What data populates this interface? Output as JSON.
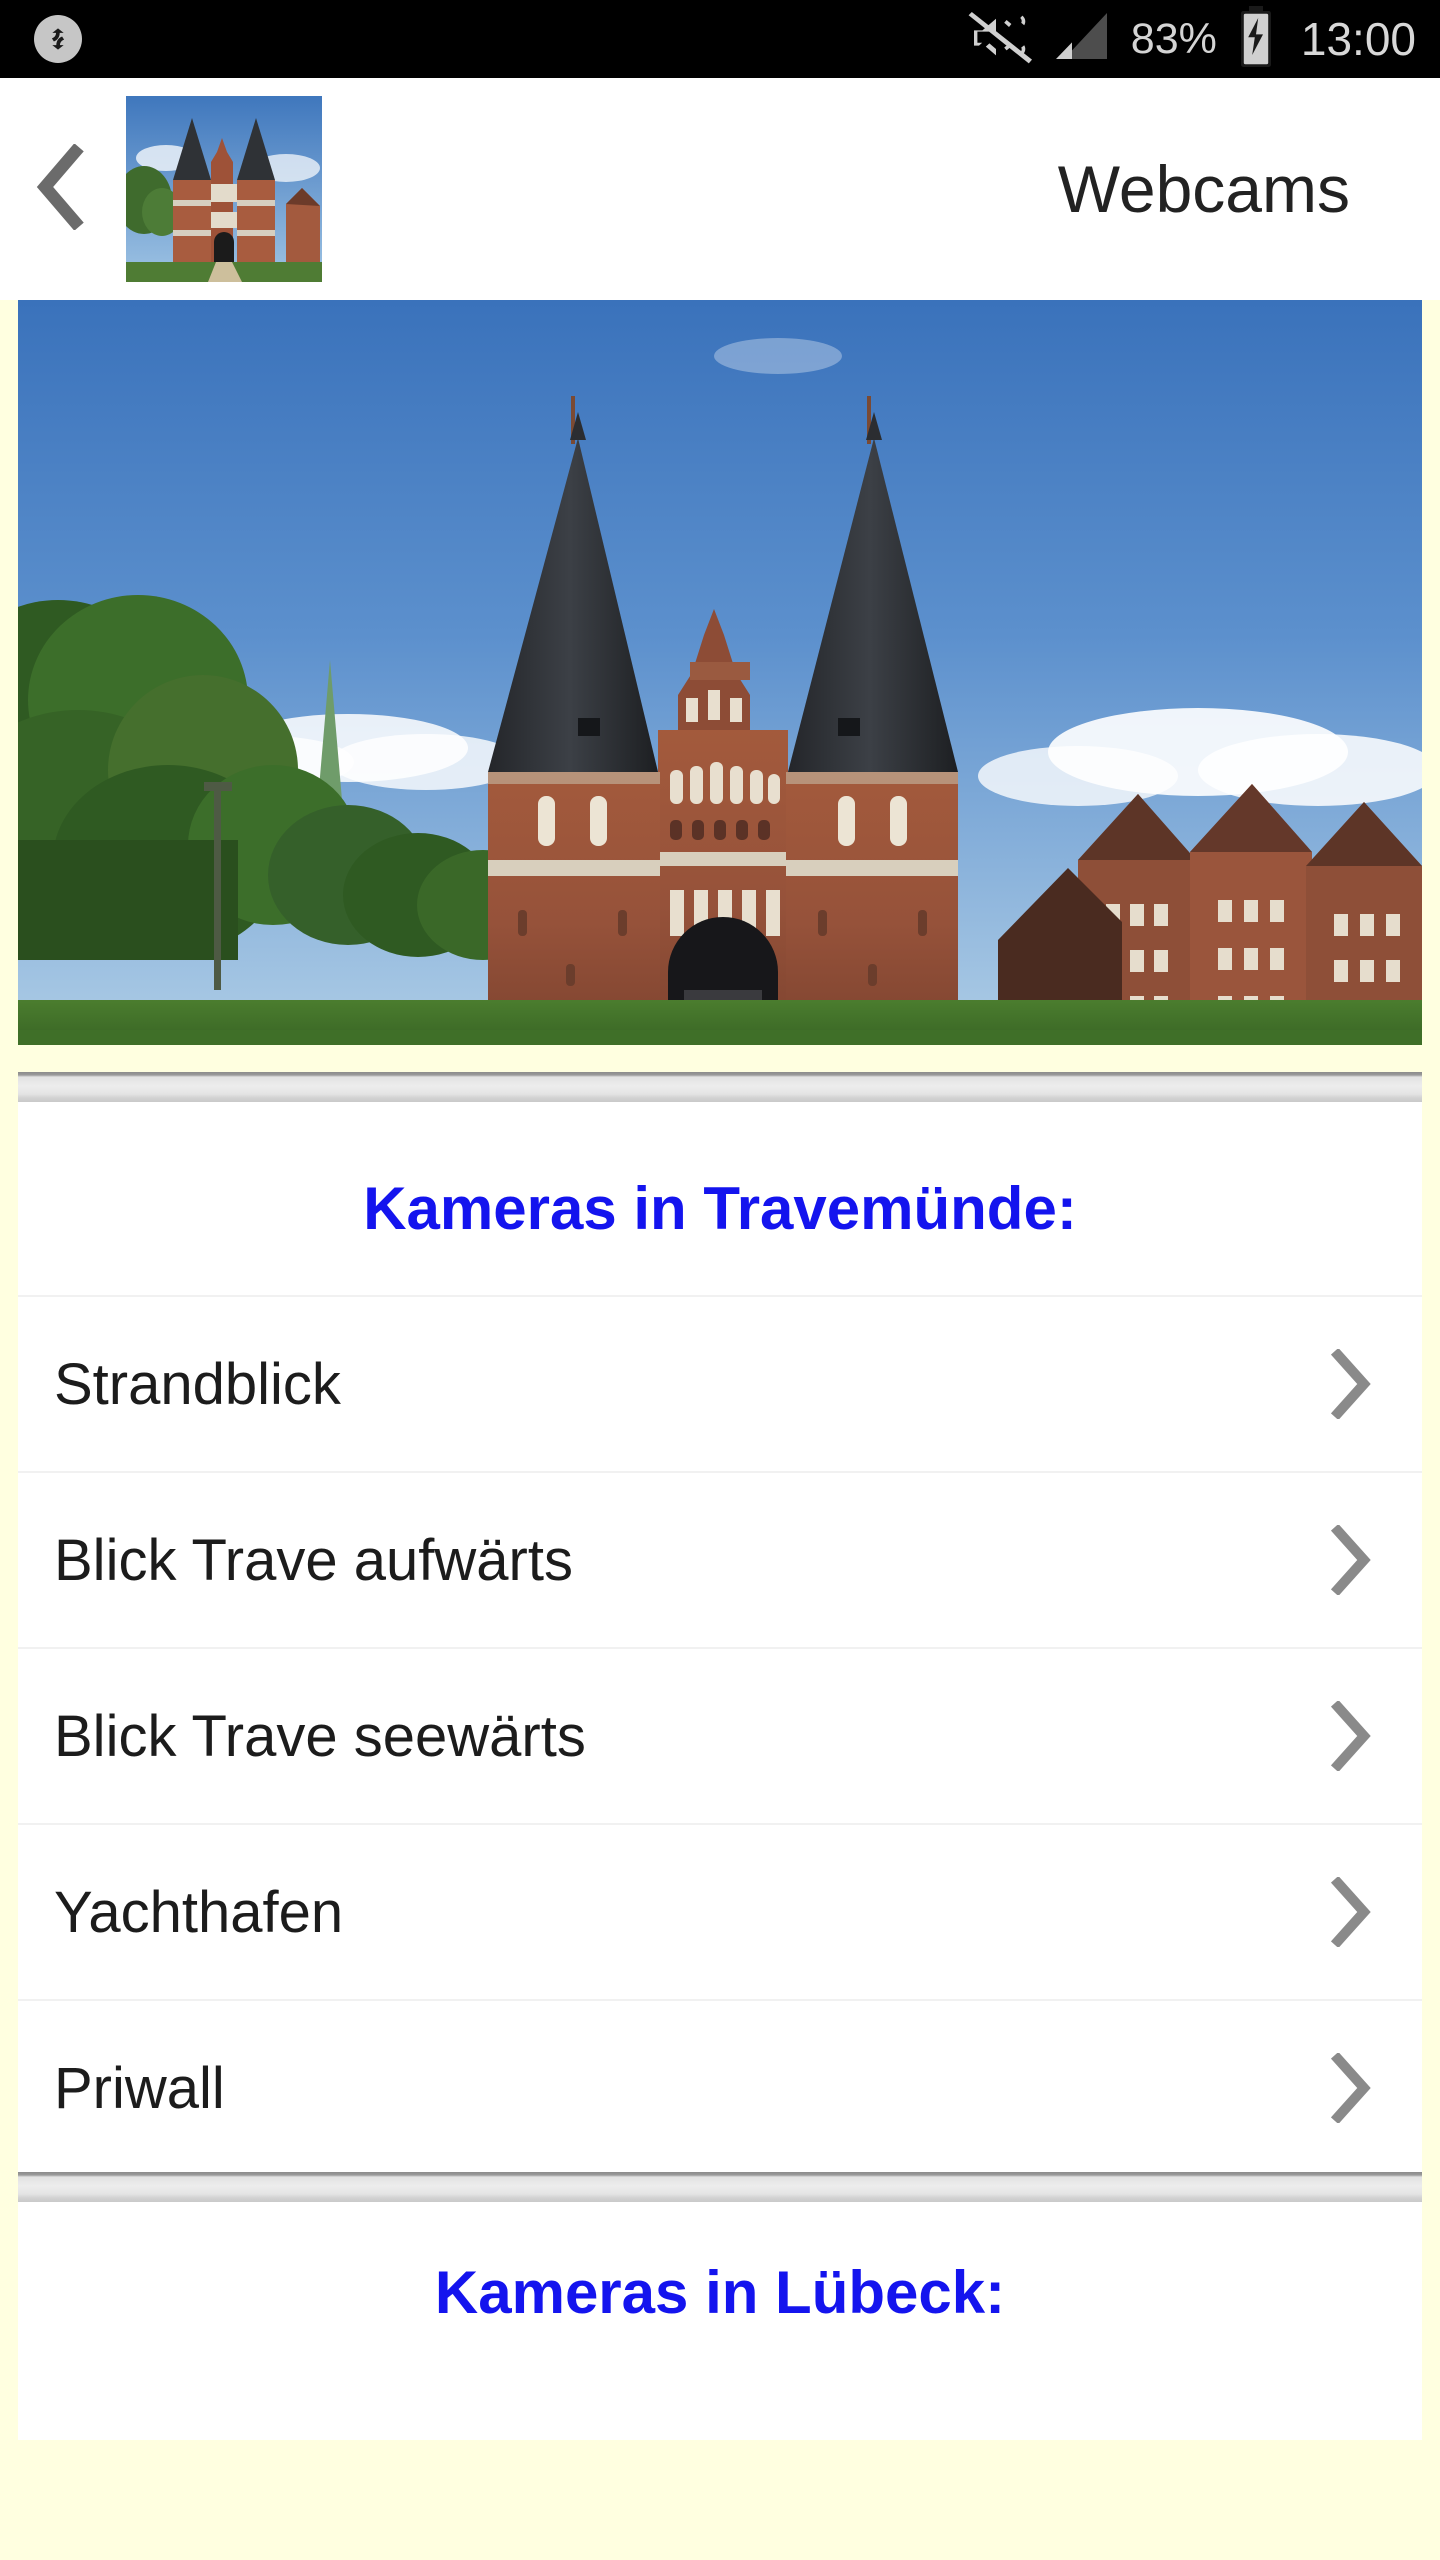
{
  "status_bar": {
    "sync_icon": "sync-icon",
    "mute_icon": "volume-muted-icon",
    "signal_icon": "signal-bars-icon",
    "battery_percent": "83%",
    "battery_icon": "battery-charging-icon",
    "clock": "13:00",
    "background_color": "#000000",
    "text_color": "#d4d4d4"
  },
  "header": {
    "back_icon": "chevron-left-icon",
    "thumbnail_icon": "holstentor-thumbnail",
    "title": "Webcams",
    "background_color": "#ffffff"
  },
  "hero": {
    "image_name": "holstentor-photo",
    "alt": "Holstentor Lübeck"
  },
  "page": {
    "background_color": "#FFFFE0",
    "heading_color": "#1414EE"
  },
  "sections": [
    {
      "heading": "Kameras in Travemünde:",
      "items": [
        {
          "label": "Strandblick",
          "chevron": "chevron-right-icon"
        },
        {
          "label": "Blick Trave aufwärts",
          "chevron": "chevron-right-icon"
        },
        {
          "label": "Blick Trave seewärts",
          "chevron": "chevron-right-icon"
        },
        {
          "label": "Yachthafen",
          "chevron": "chevron-right-icon"
        },
        {
          "label": "Priwall",
          "chevron": "chevron-right-icon"
        }
      ]
    },
    {
      "heading": "Kameras in Lübeck:",
      "items": []
    }
  ]
}
